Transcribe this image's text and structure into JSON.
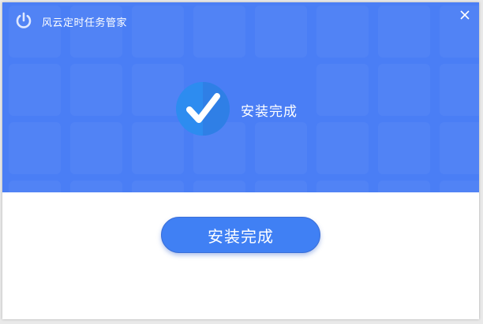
{
  "window": {
    "title": "风云定时任务管家",
    "app_icon": "power-icon",
    "close_icon": "close-icon"
  },
  "banner": {
    "status_icon": "checkmark-circle-icon",
    "status_text": "安装完成"
  },
  "actions": {
    "primary_label": "安装完成"
  },
  "colors": {
    "banner": "#4a7ef5",
    "button": "#4080f4",
    "check_circle": "#2d8cf0"
  }
}
